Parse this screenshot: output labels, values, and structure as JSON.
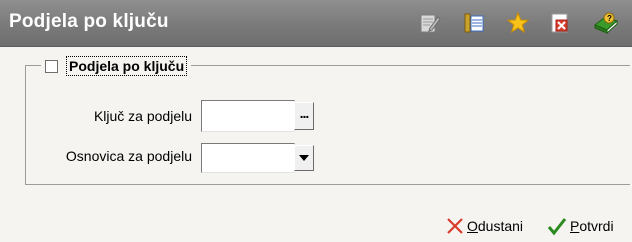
{
  "window": {
    "title": "Podjela po ključu"
  },
  "toolbar": {
    "buttons": [
      {
        "icon": "edit-icon"
      },
      {
        "icon": "list-icon"
      },
      {
        "icon": "star-icon"
      },
      {
        "icon": "pdf-close-icon"
      },
      {
        "icon": "help-books-icon"
      }
    ]
  },
  "group": {
    "checkbox_checked": false,
    "label": "Podjela po ključu"
  },
  "fields": {
    "key_label": "Ključ za podjelu",
    "key_value": "",
    "key_button": "...",
    "base_label": "Osnovica za podjelu",
    "base_value": ""
  },
  "footer": {
    "cancel_first": "O",
    "cancel_rest": "dustani",
    "confirm_first": "P",
    "confirm_rest": "otvrdi"
  },
  "colors": {
    "titlebar": "#7a7a7a",
    "cancel_icon": "#d93a2b",
    "confirm_icon": "#2c8a1e",
    "star": "#f7c21a"
  }
}
